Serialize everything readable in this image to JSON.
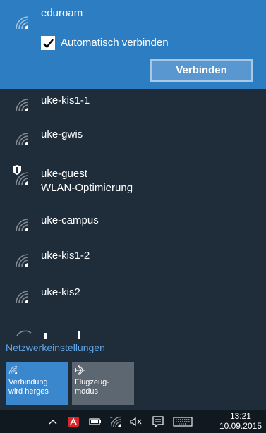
{
  "selected_network": {
    "name": "eduroam",
    "auto_connect_label": "Automatisch verbinden",
    "auto_connect_checked": true,
    "connect_button_label": "Verbinden",
    "icon": "wifi-signal-icon"
  },
  "networks": [
    {
      "name": "uke-kis1-1",
      "icon": "wifi-signal-icon"
    },
    {
      "name": "uke-gwis",
      "icon": "wifi-signal-icon"
    },
    {
      "name": "uke-guest",
      "subtitle": "WLAN-Optimierung",
      "icon": "wifi-signal-icon",
      "badge": "shield-icon"
    },
    {
      "name": "uke-campus",
      "icon": "wifi-signal-icon"
    },
    {
      "name": "uke-kis1-2",
      "icon": "wifi-signal-icon"
    },
    {
      "name": "uke-kis2",
      "icon": "wifi-signal-icon"
    }
  ],
  "settings_link": "Netzwerkeinstellungen",
  "tiles": [
    {
      "line1": "Verbindung",
      "line2": "wird herges",
      "icon": "wifi-icon",
      "active": true
    },
    {
      "line1": "Flugzeug-",
      "line2": "modus",
      "icon": "airplane-icon",
      "active": false
    }
  ],
  "taskbar": {
    "time": "13:21",
    "date": "10.09.2015",
    "icons": [
      "chevron-up-icon",
      "avira-icon",
      "battery-icon",
      "network-icon",
      "volume-muted-icon",
      "action-center-icon",
      "keyboard-icon"
    ]
  },
  "colors": {
    "selected_bg": "#2d7dc2",
    "panel_bg": "#1f2d3b",
    "link": "#60a6e6",
    "taskbar_bg": "#101820"
  }
}
